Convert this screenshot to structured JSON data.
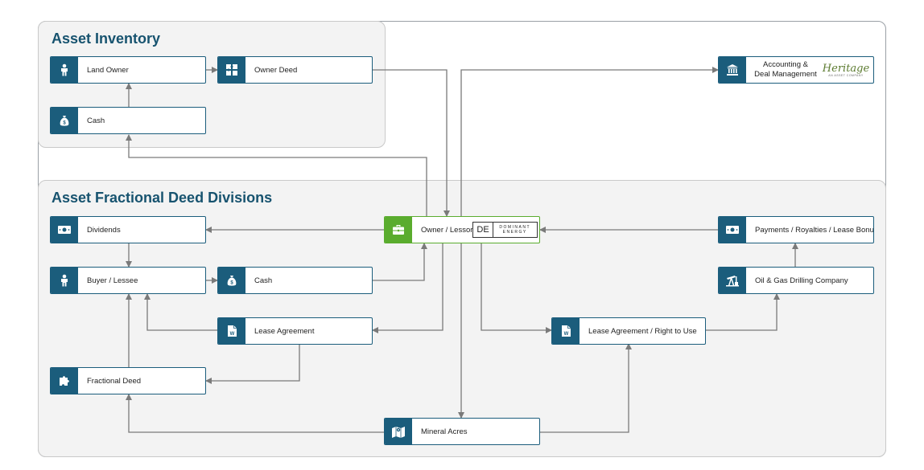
{
  "sections": {
    "inventory_title": "Asset Inventory",
    "fractional_title": "Asset Fractional Deed Divisions"
  },
  "nodes": {
    "land_owner": "Land Owner",
    "owner_deed": "Owner Deed",
    "cash_inventory": "Cash",
    "accounting_line1": "Accounting &",
    "accounting_line2": "Deal Management",
    "dividends": "Dividends",
    "owner_lessor": "Owner / Lessor",
    "payments": "Payments / Royalties / Lease Bonus",
    "buyer_lessee": "Buyer / Lessee",
    "cash_fractional": "Cash",
    "oil_gas": "Oil & Gas Drilling Company",
    "lease_agreement": "Lease Agreement",
    "lease_right": "Lease Agreement / Right to Use",
    "fractional_deed": "Fractional Deed",
    "mineral_acres": "Mineral Acres"
  },
  "logos": {
    "dominant_mark": "DE",
    "dominant_text": "DOMINANT ENERGY",
    "heritage_name": "Heritage",
    "heritage_sub": "AN ASSET COMPANY"
  },
  "colors": {
    "node_blue": "#1b5d7c",
    "center_green": "#5aac2e",
    "connector_gray": "#7a7a7a",
    "title_blue": "#17536f"
  },
  "icons": {
    "land_owner": "person-icon",
    "owner_deed": "puzzle-icon",
    "cash": "money-bag-icon",
    "accounting": "bank-icon",
    "dividends": "banknote-icon",
    "owner_lessor": "briefcase-icon",
    "payments": "banknote-icon",
    "buyer_lessee": "person-icon",
    "oil_gas": "oil-pump-icon",
    "lease": "document-icon",
    "fractional_deed": "puzzle-piece-icon",
    "mineral_acres": "map-icon"
  }
}
